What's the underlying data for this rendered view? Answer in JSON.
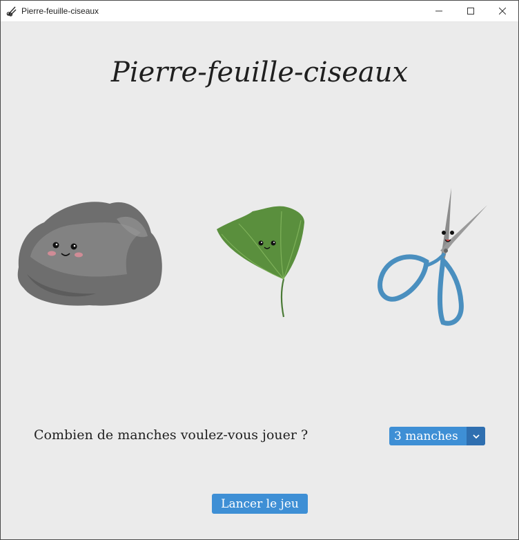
{
  "window": {
    "title": "Pierre-feuille-ciseaux",
    "app_icon": "scissors-icon",
    "controls": [
      "minimize-icon",
      "maximize-icon",
      "close-icon"
    ]
  },
  "main": {
    "heading": "Pierre-feuille-ciseaux",
    "choices": [
      {
        "name": "rock",
        "icon": "rock-image"
      },
      {
        "name": "leaf",
        "icon": "leaf-image"
      },
      {
        "name": "scissors",
        "icon": "scissors-image"
      }
    ],
    "rounds_question": "Combien de manches voulez-vous jouer ?",
    "rounds_select": {
      "value": "3 manches"
    },
    "launch_button": "Lancer le jeu"
  },
  "colors": {
    "background": "#ebebeb",
    "accent": "#3e8fd5",
    "accent_dark": "#2f6fb0"
  }
}
